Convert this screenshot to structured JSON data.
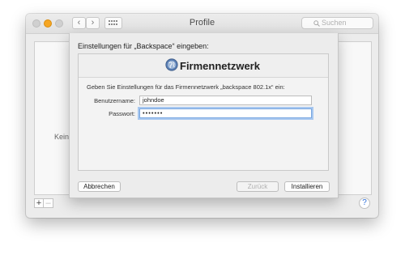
{
  "window": {
    "title": "Profile",
    "search_placeholder": "Suchen",
    "nav_back": "‹",
    "nav_forward": "›",
    "empty_label": "Keine P",
    "add_label": "+",
    "remove_label": "–",
    "help_label": "?"
  },
  "sheet": {
    "title": "Einstellungen für „Backspace“ eingeben:",
    "network_title": "Firmennetzwerk",
    "prompt": "Geben Sie Einstellungen für das Firmennetzwerk „backspace 802.1x“ ein:",
    "username_label": "Benutzername:",
    "username_value": "johndoe",
    "password_label": "Passwort:",
    "password_value": "•••••••",
    "cancel_label": "Abbrechen",
    "back_label": "Zurück",
    "install_label": "Installieren"
  },
  "colors": {
    "focus_ring": "#a8c8f0",
    "help_accent": "#2e6fd9",
    "minimize_light": "#f5a623"
  }
}
